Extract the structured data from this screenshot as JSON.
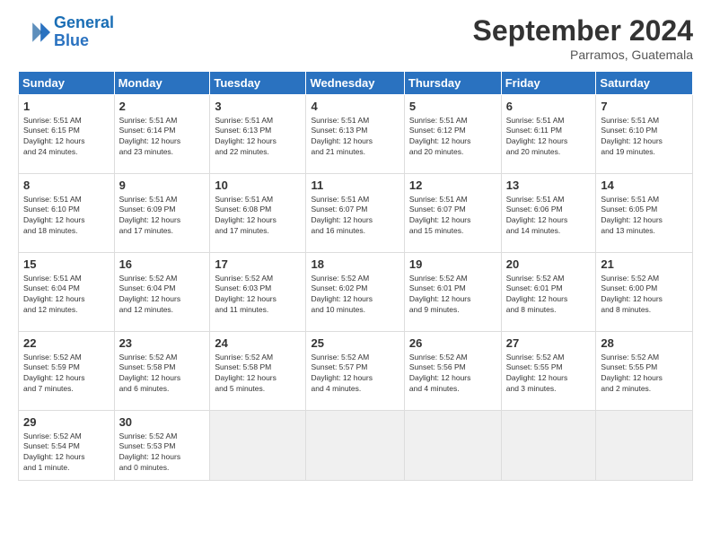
{
  "header": {
    "logo_line1": "General",
    "logo_line2": "Blue",
    "month": "September 2024",
    "location": "Parramos, Guatemala"
  },
  "weekdays": [
    "Sunday",
    "Monday",
    "Tuesday",
    "Wednesday",
    "Thursday",
    "Friday",
    "Saturday"
  ],
  "weeks": [
    [
      {
        "day": "1",
        "info": "Sunrise: 5:51 AM\nSunset: 6:15 PM\nDaylight: 12 hours\nand 24 minutes."
      },
      {
        "day": "2",
        "info": "Sunrise: 5:51 AM\nSunset: 6:14 PM\nDaylight: 12 hours\nand 23 minutes."
      },
      {
        "day": "3",
        "info": "Sunrise: 5:51 AM\nSunset: 6:13 PM\nDaylight: 12 hours\nand 22 minutes."
      },
      {
        "day": "4",
        "info": "Sunrise: 5:51 AM\nSunset: 6:13 PM\nDaylight: 12 hours\nand 21 minutes."
      },
      {
        "day": "5",
        "info": "Sunrise: 5:51 AM\nSunset: 6:12 PM\nDaylight: 12 hours\nand 20 minutes."
      },
      {
        "day": "6",
        "info": "Sunrise: 5:51 AM\nSunset: 6:11 PM\nDaylight: 12 hours\nand 20 minutes."
      },
      {
        "day": "7",
        "info": "Sunrise: 5:51 AM\nSunset: 6:10 PM\nDaylight: 12 hours\nand 19 minutes."
      }
    ],
    [
      {
        "day": "8",
        "info": "Sunrise: 5:51 AM\nSunset: 6:10 PM\nDaylight: 12 hours\nand 18 minutes."
      },
      {
        "day": "9",
        "info": "Sunrise: 5:51 AM\nSunset: 6:09 PM\nDaylight: 12 hours\nand 17 minutes."
      },
      {
        "day": "10",
        "info": "Sunrise: 5:51 AM\nSunset: 6:08 PM\nDaylight: 12 hours\nand 17 minutes."
      },
      {
        "day": "11",
        "info": "Sunrise: 5:51 AM\nSunset: 6:07 PM\nDaylight: 12 hours\nand 16 minutes."
      },
      {
        "day": "12",
        "info": "Sunrise: 5:51 AM\nSunset: 6:07 PM\nDaylight: 12 hours\nand 15 minutes."
      },
      {
        "day": "13",
        "info": "Sunrise: 5:51 AM\nSunset: 6:06 PM\nDaylight: 12 hours\nand 14 minutes."
      },
      {
        "day": "14",
        "info": "Sunrise: 5:51 AM\nSunset: 6:05 PM\nDaylight: 12 hours\nand 13 minutes."
      }
    ],
    [
      {
        "day": "15",
        "info": "Sunrise: 5:51 AM\nSunset: 6:04 PM\nDaylight: 12 hours\nand 12 minutes."
      },
      {
        "day": "16",
        "info": "Sunrise: 5:52 AM\nSunset: 6:04 PM\nDaylight: 12 hours\nand 12 minutes."
      },
      {
        "day": "17",
        "info": "Sunrise: 5:52 AM\nSunset: 6:03 PM\nDaylight: 12 hours\nand 11 minutes."
      },
      {
        "day": "18",
        "info": "Sunrise: 5:52 AM\nSunset: 6:02 PM\nDaylight: 12 hours\nand 10 minutes."
      },
      {
        "day": "19",
        "info": "Sunrise: 5:52 AM\nSunset: 6:01 PM\nDaylight: 12 hours\nand 9 minutes."
      },
      {
        "day": "20",
        "info": "Sunrise: 5:52 AM\nSunset: 6:01 PM\nDaylight: 12 hours\nand 8 minutes."
      },
      {
        "day": "21",
        "info": "Sunrise: 5:52 AM\nSunset: 6:00 PM\nDaylight: 12 hours\nand 8 minutes."
      }
    ],
    [
      {
        "day": "22",
        "info": "Sunrise: 5:52 AM\nSunset: 5:59 PM\nDaylight: 12 hours\nand 7 minutes."
      },
      {
        "day": "23",
        "info": "Sunrise: 5:52 AM\nSunset: 5:58 PM\nDaylight: 12 hours\nand 6 minutes."
      },
      {
        "day": "24",
        "info": "Sunrise: 5:52 AM\nSunset: 5:58 PM\nDaylight: 12 hours\nand 5 minutes."
      },
      {
        "day": "25",
        "info": "Sunrise: 5:52 AM\nSunset: 5:57 PM\nDaylight: 12 hours\nand 4 minutes."
      },
      {
        "day": "26",
        "info": "Sunrise: 5:52 AM\nSunset: 5:56 PM\nDaylight: 12 hours\nand 4 minutes."
      },
      {
        "day": "27",
        "info": "Sunrise: 5:52 AM\nSunset: 5:55 PM\nDaylight: 12 hours\nand 3 minutes."
      },
      {
        "day": "28",
        "info": "Sunrise: 5:52 AM\nSunset: 5:55 PM\nDaylight: 12 hours\nand 2 minutes."
      }
    ],
    [
      {
        "day": "29",
        "info": "Sunrise: 5:52 AM\nSunset: 5:54 PM\nDaylight: 12 hours\nand 1 minute."
      },
      {
        "day": "30",
        "info": "Sunrise: 5:52 AM\nSunset: 5:53 PM\nDaylight: 12 hours\nand 0 minutes."
      },
      null,
      null,
      null,
      null,
      null
    ]
  ]
}
